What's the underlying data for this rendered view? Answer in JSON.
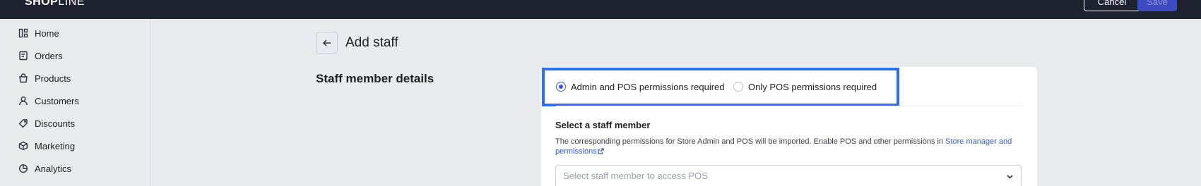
{
  "app": {
    "logo_bold": "SHOP",
    "logo_light": "LINE"
  },
  "header": {
    "cancel_label": "Cancel",
    "save_label": "Save"
  },
  "sidebar": {
    "items": [
      {
        "label": "Home",
        "icon": "home-icon"
      },
      {
        "label": "Orders",
        "icon": "orders-icon"
      },
      {
        "label": "Products",
        "icon": "products-icon"
      },
      {
        "label": "Customers",
        "icon": "customers-icon"
      },
      {
        "label": "Discounts",
        "icon": "discount-tag-icon"
      },
      {
        "label": "Marketing",
        "icon": "marketing-cube-icon"
      },
      {
        "label": "Analytics",
        "icon": "analytics-pie-icon"
      }
    ]
  },
  "page": {
    "title": "Add staff",
    "section_title": "Staff member details"
  },
  "permissions": {
    "options": [
      {
        "label": "Admin and POS permissions required",
        "selected": true
      },
      {
        "label": "Only POS permissions required",
        "selected": false
      }
    ]
  },
  "staff_select": {
    "title": "Select a staff member",
    "description": "The corresponding permissions for Store Admin and POS will be imported. Enable POS and other permissions in ",
    "link_text": "Store manager and permissions",
    "placeholder": "Select staff member to access POS"
  },
  "colors": {
    "topbar": "#1f2231",
    "accent": "#3c55d6",
    "highlight": "#2f6df2"
  }
}
